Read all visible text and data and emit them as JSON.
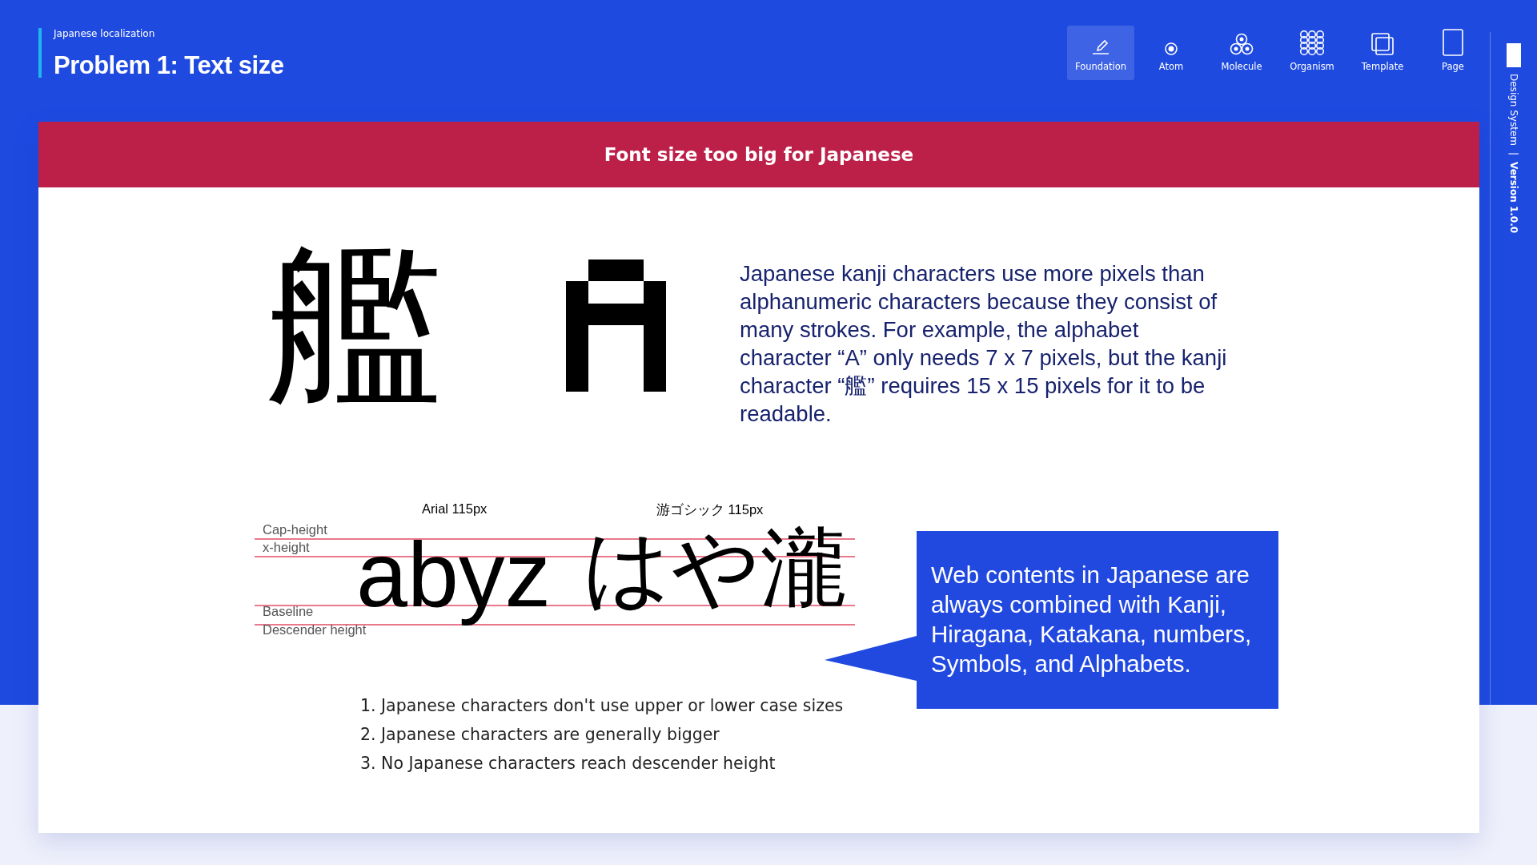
{
  "header": {
    "subtitle": "Japanese localization",
    "title": "Problem 1: Text size"
  },
  "nav": [
    {
      "kind": "foundation",
      "label": "Foundation",
      "selected": true
    },
    {
      "kind": "atom",
      "label": "Atom",
      "selected": false
    },
    {
      "kind": "molecule",
      "label": "Molecule",
      "selected": false
    },
    {
      "kind": "organism",
      "label": "Organism",
      "selected": false
    },
    {
      "kind": "template",
      "label": "Template",
      "selected": false
    },
    {
      "kind": "page",
      "label": "Page",
      "selected": false
    }
  ],
  "sidebar": {
    "label": "Design System",
    "separator": "|",
    "version": "Version 1.0.0"
  },
  "banner": "Font size too big for Japanese",
  "kanji_example": "艦",
  "description": "Japanese kanji characters use more pixels than alphanumeric characters because they consist of many strokes. For example, the alphabet character “A” only needs 7 x 7 pixels, but the kanji character “艦” requires 15 x 15 pixels for it to be readable.",
  "diagram": {
    "font_labels": [
      "Arial 115px",
      "游ゴシック 115px"
    ],
    "guides": [
      "Cap-height",
      "x-height",
      "Baseline",
      "Descender height"
    ],
    "latin_sample": "abyz",
    "japanese_sample": "はや瀧"
  },
  "callout": "Web contents in Japanese are always combined with Kanji, Hiragana, Katakana, numbers, Symbols, and Alphabets.",
  "points": [
    "1. Japanese characters don't use upper or lower case sizes",
    "2. Japanese characters are generally bigger",
    "3. No Japanese characters reach descender height"
  ]
}
